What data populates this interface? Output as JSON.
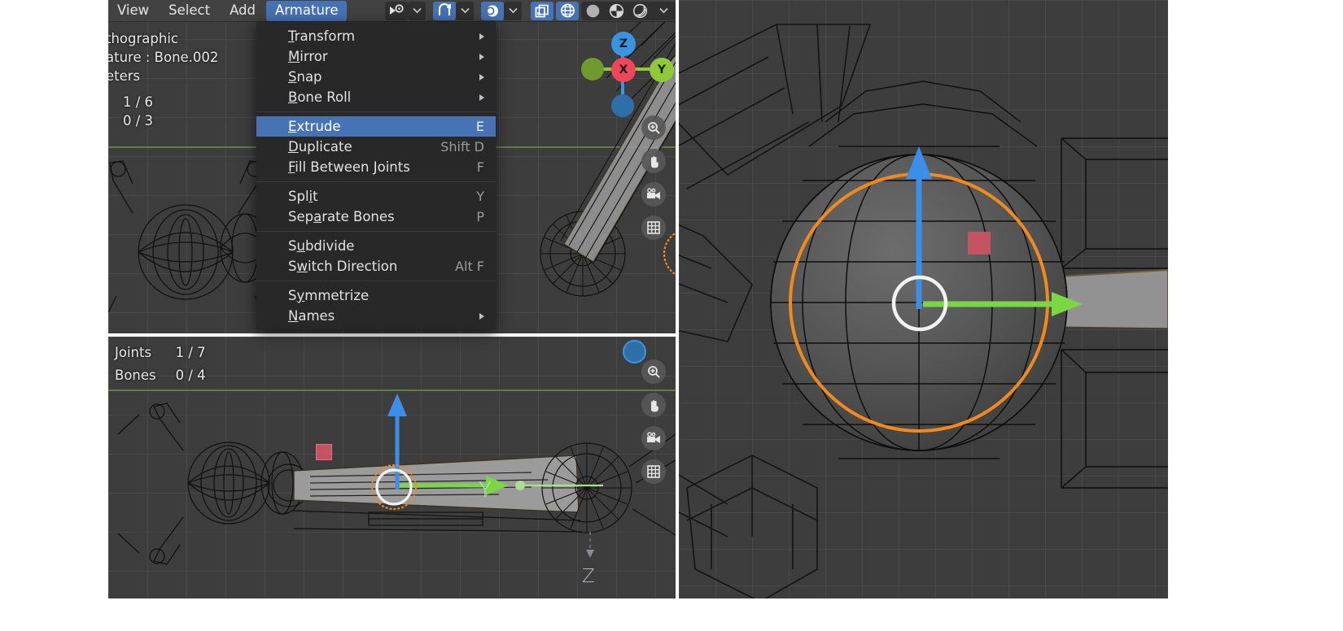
{
  "app": "blender-3d-viewport",
  "header": {
    "menus": [
      {
        "label": "View",
        "active": false
      },
      {
        "label": "Select",
        "active": false
      },
      {
        "label": "Add",
        "active": false
      },
      {
        "label": "Armature",
        "active": true
      }
    ],
    "tool_buttons": [
      {
        "name": "visibility-eye-icon",
        "selected": false
      },
      {
        "name": "chevron-down-icon",
        "selected": false
      },
      {
        "name": "snap-magnet-icon",
        "selected": true
      },
      {
        "name": "chevron-down-icon",
        "selected": false
      },
      {
        "name": "proportional-editing-icon",
        "selected": true
      },
      {
        "name": "chevron-down-icon",
        "selected": false
      }
    ],
    "overlay_buttons": [
      {
        "name": "show-gizmo-icon",
        "selected": true
      },
      {
        "name": "show-overlays-icon",
        "selected": true
      }
    ],
    "shading_modes": [
      {
        "name": "wireframe-shading-icon",
        "selected": false
      },
      {
        "name": "solid-shading-icon",
        "selected": false
      },
      {
        "name": "material-preview-shading-icon",
        "selected": false
      },
      {
        "name": "rendered-shading-icon",
        "selected": false
      },
      {
        "name": "shading-options-chevron-icon",
        "selected": false
      }
    ]
  },
  "armature_menu": {
    "title": "Armature",
    "groups": [
      {
        "items": [
          {
            "label": "Transform",
            "accel": "T",
            "shortcut": "",
            "submenu": true,
            "highlighted": false
          },
          {
            "label": "Mirror",
            "accel": "M",
            "shortcut": "",
            "submenu": true,
            "highlighted": false
          },
          {
            "label": "Snap",
            "accel": "S",
            "shortcut": "",
            "submenu": true,
            "highlighted": false
          },
          {
            "label": "Bone Roll",
            "accel": "B",
            "shortcut": "",
            "submenu": true,
            "highlighted": false
          }
        ]
      },
      {
        "items": [
          {
            "label": "Extrude",
            "accel": "E",
            "shortcut": "E",
            "submenu": false,
            "highlighted": true
          },
          {
            "label": "Duplicate",
            "accel": "D",
            "shortcut": "Shift D",
            "submenu": false,
            "highlighted": false
          },
          {
            "label": "Fill Between Joints",
            "accel": "F",
            "shortcut": "F",
            "submenu": false,
            "highlighted": false
          }
        ]
      },
      {
        "items": [
          {
            "label": "Split",
            "accel": "i",
            "shortcut": "Y",
            "submenu": false,
            "highlighted": false
          },
          {
            "label": "Separate Bones",
            "accel": "a",
            "shortcut": "P",
            "submenu": false,
            "highlighted": false
          }
        ]
      },
      {
        "items": [
          {
            "label": "Subdivide",
            "accel": "u",
            "shortcut": "",
            "submenu": false,
            "highlighted": false
          },
          {
            "label": "Switch Direction",
            "accel": "w",
            "shortcut": "Alt F",
            "submenu": false,
            "highlighted": false
          }
        ]
      },
      {
        "items": [
          {
            "label": "Symmetrize",
            "accel": "y",
            "shortcut": "",
            "submenu": false,
            "highlighted": false
          },
          {
            "label": "Names",
            "accel": "N",
            "shortcut": "",
            "submenu": true,
            "highlighted": false
          }
        ]
      }
    ]
  },
  "viewport_top": {
    "info_lines": [
      "thographic",
      "ature : Bone.002",
      "eters"
    ],
    "stats": [
      {
        "label": "",
        "value": "1 / 6"
      },
      {
        "label": "",
        "value": "0 / 3"
      }
    ],
    "gizmo": {
      "axis_x": "X",
      "axis_y": "Y",
      "axis_z": "Z",
      "color_x": "#f0465c",
      "color_y": "#8fc93a",
      "color_z": "#3b94e0"
    },
    "nav_buttons": [
      {
        "name": "zoom-icon"
      },
      {
        "name": "pan-hand-icon"
      },
      {
        "name": "camera-view-icon"
      },
      {
        "name": "toggle-orthographic-icon"
      }
    ]
  },
  "viewport_bottom": {
    "stats": [
      {
        "label": "Joints",
        "value": "1 / 7"
      },
      {
        "label": "Bones",
        "value": "0 / 4"
      }
    ],
    "axis_labels": [
      {
        "text": "Y",
        "color": "#b9e6b9"
      },
      {
        "text": "Z",
        "color": "#b8b8c8"
      }
    ],
    "nav_buttons": [
      {
        "name": "zoom-icon"
      },
      {
        "name": "pan-hand-icon"
      },
      {
        "name": "camera-view-icon"
      },
      {
        "name": "toggle-orthographic-icon"
      }
    ]
  },
  "colors": {
    "viewport_bg": "#3d3d3d",
    "header_bg": "#424242",
    "menu_bg": "#282828",
    "accent_blue": "#4772b3",
    "axis_x_red": "#f0465c",
    "axis_y_green": "#8fc93a",
    "axis_z_blue": "#3b94e0",
    "selection_orange": "#f08a1e",
    "arrow_green": "#7ad642",
    "arrow_blue": "#3b8fe8",
    "ground_line_green": "#6f8e4a"
  }
}
